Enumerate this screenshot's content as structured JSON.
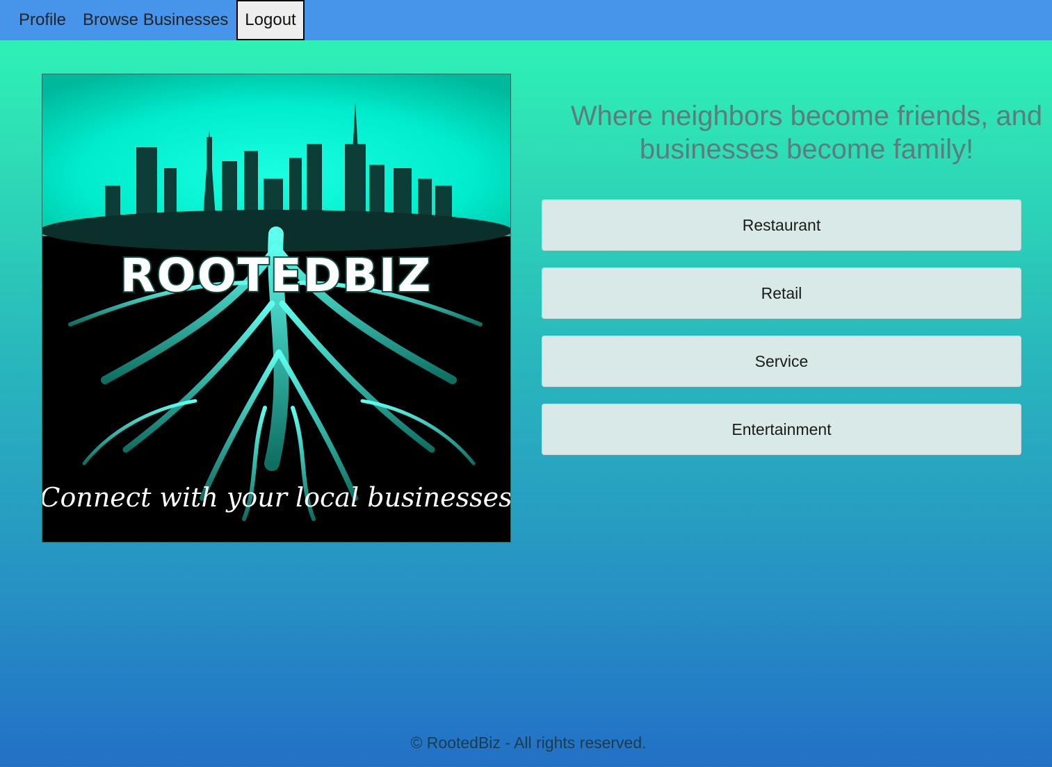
{
  "nav": {
    "profile_label": "Profile",
    "browse_label": "Browse Businesses",
    "logout_label": "Logout"
  },
  "logo": {
    "wordmark": "ROOTEDBIZ",
    "slogan": "Connect with your local businesses"
  },
  "tagline": "Where neighbors become friends, and businesses become family!",
  "categories": [
    {
      "label": "Restaurant"
    },
    {
      "label": "Retail"
    },
    {
      "label": "Service"
    },
    {
      "label": "Entertainment"
    }
  ],
  "footer": {
    "text": "© RootedBiz - All rights reserved."
  },
  "colors": {
    "navbar": "#4695ea",
    "accent_teal": "#00f0cc",
    "button_bg": "#d8e9e8",
    "tagline_text": "#5f7c7c"
  }
}
